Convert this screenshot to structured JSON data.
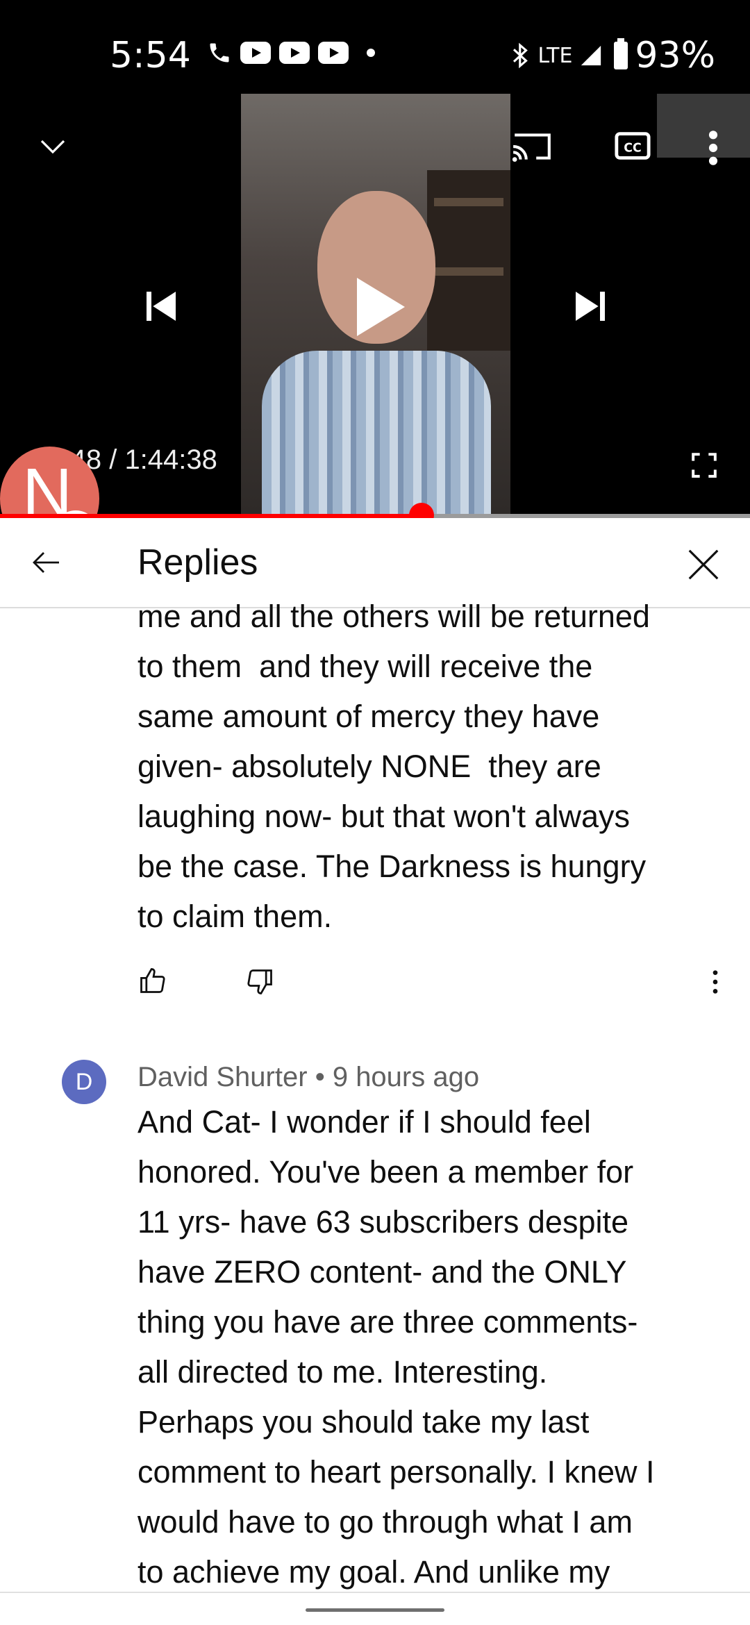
{
  "status_bar": {
    "time": "5:54",
    "network": "LTE",
    "battery": "93%",
    "icons": [
      "phone-icon",
      "youtube-icon",
      "youtube-icon",
      "youtube-icon",
      "dot-icon",
      "bluetooth-icon",
      "signal-icon",
      "battery-icon"
    ]
  },
  "player": {
    "time_display": "58:48 / 1:44:38",
    "progress_fraction": 0.5621,
    "call_bubble_letter": "N",
    "colors": {
      "progress": "#ff0000",
      "call_bubble": "#e26a5d"
    },
    "icons": [
      "chevron-down-icon",
      "cast-icon",
      "cc-icon",
      "more-vert-icon",
      "skip-previous-icon",
      "play-icon",
      "skip-next-icon",
      "fullscreen-icon"
    ]
  },
  "replies_panel": {
    "title": "Replies",
    "previous_comment": {
      "text": "me and all the others will be returned\nto them  and they will receive the\nsame amount of mercy they have\ngiven- absolutely NONE  they are\nlaughing now- but that won't always\nbe the case. The Darkness is hungry\nto claim them."
    },
    "reply": {
      "avatar_letter": "D",
      "author": "David Shurter",
      "separator": "•",
      "time": "9 hours ago",
      "text": "And Cat- I wonder if I should feel\nhonored. You've been a member for\n11 yrs- have 63 subscribers despite\nhave ZERO content- and the ONLY\nthing you have are three comments-\nall directed to me. Interesting.\nPerhaps you should take my last\ncomment to heart personally. I knew I\nwould have to go through what I am\nto achieve my goal. And unlike my",
      "avatar_color": "#5c6bc0"
    }
  }
}
